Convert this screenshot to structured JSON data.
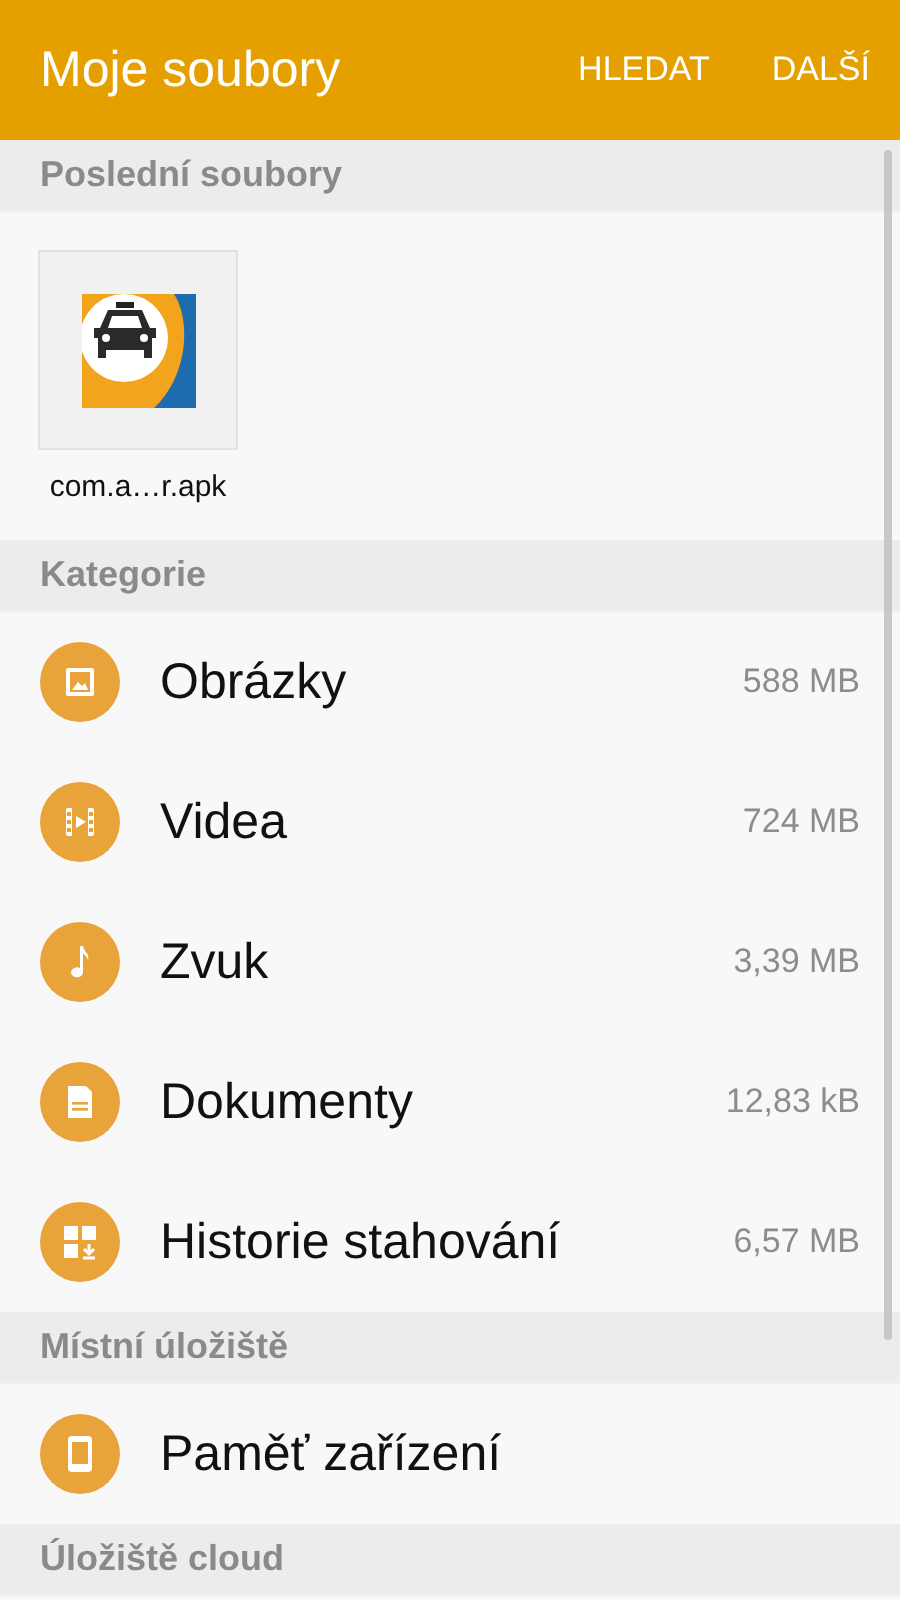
{
  "app_bar": {
    "title": "Moje soubory",
    "actions": [
      "HLEDAT",
      "DALŠÍ"
    ]
  },
  "sections": [
    {
      "kind": "recent",
      "title": "Poslední soubory",
      "files": [
        {
          "name": "com.a…r.apk"
        }
      ]
    },
    {
      "kind": "list",
      "title": "Kategorie",
      "items": [
        {
          "kind": "image",
          "label": "Obrázky",
          "size": "588 MB"
        },
        {
          "kind": "video",
          "label": "Videa",
          "size": "724 MB"
        },
        {
          "kind": "audio",
          "label": "Zvuk",
          "size": "3,39 MB"
        },
        {
          "kind": "document",
          "label": "Dokumenty",
          "size": "12,83 kB"
        },
        {
          "kind": "download",
          "label": "Historie stahování",
          "size": "6,57 MB"
        }
      ]
    },
    {
      "kind": "list",
      "title": "Místní úložiště",
      "items": [
        {
          "kind": "device",
          "label": "Paměť zařízení"
        }
      ]
    },
    {
      "kind": "list",
      "title": "Úložiště cloud"
    }
  ]
}
